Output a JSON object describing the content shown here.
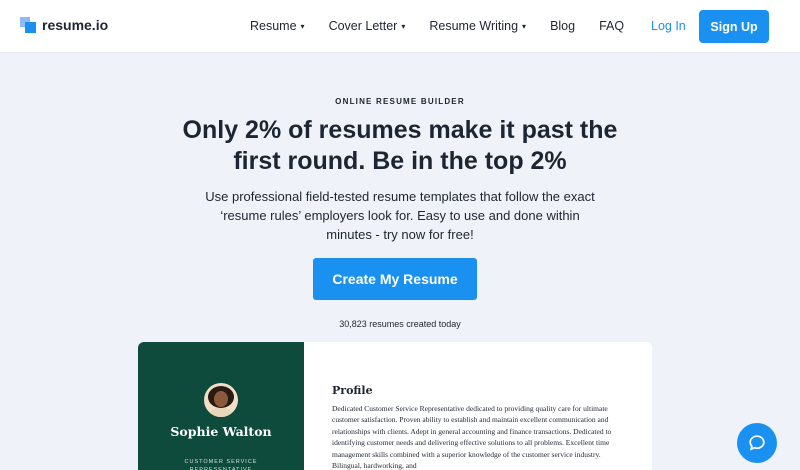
{
  "brand": {
    "name": "resume.io"
  },
  "nav": {
    "items": [
      {
        "label": "Resume",
        "dropdown": true
      },
      {
        "label": "Cover Letter",
        "dropdown": true
      },
      {
        "label": "Resume Writing",
        "dropdown": true
      },
      {
        "label": "Blog",
        "dropdown": false
      },
      {
        "label": "FAQ",
        "dropdown": false
      }
    ],
    "login": "Log In",
    "signup": "Sign Up"
  },
  "hero": {
    "eyebrow": "ONLINE RESUME BUILDER",
    "headline_line1": "Only 2% of resumes make it past the",
    "headline_line2": "first round. Be in the top 2%",
    "sub_line1": "Use professional field-tested resume templates that follow the exact",
    "sub_line2": "‘resume rules’ employers look for. Easy to use and done within",
    "sub_line3": "minutes - try now for free!",
    "cta": "Create My Resume",
    "count": "30,823 resumes created today"
  },
  "resume_preview": {
    "name": "Sophie Walton",
    "role": "CUSTOMER SERVICE REPRESENTATIVE",
    "section_title": "Profile",
    "profile_text": "Dedicated Customer Service Representative dedicated to providing quality care for ultimate customer satisfaction. Proven ability to establish and maintain excellent communication and relationships with clients. Adept in general accounting and finance transactions. Dedicated to identifying customer needs and delivering effective solutions to all problems. Excellent time management skills combined with a superior knowledge of the customer service industry. Bilingual, hardworking, and"
  },
  "colors": {
    "accent": "#1a91f0",
    "hero_bg": "#eff2f9",
    "resume_sidebar": "#0f4b3c",
    "text": "#1e2532"
  },
  "icons": {
    "logo": "resume-io-logo-icon",
    "chevron": "chevron-down-icon",
    "chat": "chat-bubble-icon"
  }
}
